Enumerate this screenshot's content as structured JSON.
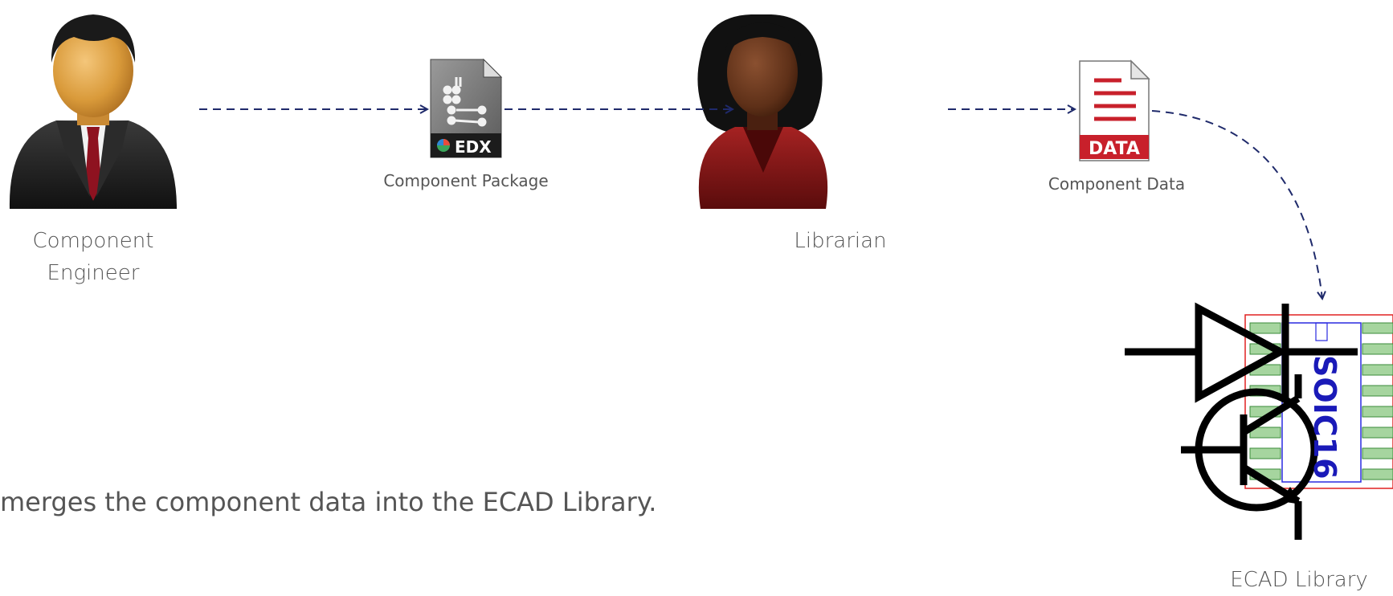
{
  "actors": {
    "engineer": {
      "label_line1": "Component",
      "label_line2": "Engineer"
    },
    "librarian": {
      "label": "Librarian"
    }
  },
  "artifacts": {
    "package": {
      "label": "Component Package",
      "badge": "EDX"
    },
    "data": {
      "label": "Component Data",
      "badge": "DATA"
    },
    "library": {
      "label": "ECAD Library",
      "chip_text": "SOIC16"
    }
  },
  "caption": "merges the component data into the ECAD Library.",
  "colors": {
    "arrow": "#1f2a6b",
    "data_red": "#c8202b",
    "pad_green": "#a6d59f",
    "chip_blue": "#1a1ab8",
    "suit_dark": "#2a2a2a",
    "blouse_red": "#8f1a1a"
  }
}
